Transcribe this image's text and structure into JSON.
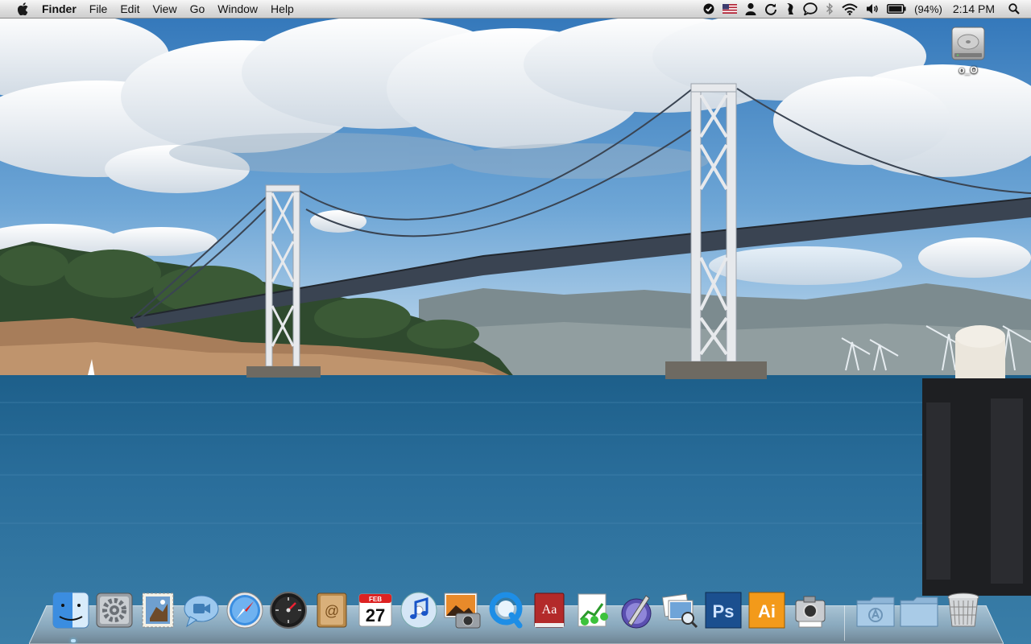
{
  "menubar": {
    "apple_icon": "apple-logo",
    "app_name": "Finder",
    "menus": [
      "File",
      "Edit",
      "View",
      "Go",
      "Window",
      "Help"
    ],
    "status_items": [
      "checkmark-circle-icon",
      "us-flag-icon",
      "user-icon",
      "time-machine-sync-icon",
      "script-icon",
      "speech-bubble-icon",
      "bluetooth-icon",
      "wifi-icon",
      "volume-icon",
      "battery-icon"
    ],
    "battery_percent": "(94%)",
    "battery_level": 0.94,
    "clock": "2:14 PM",
    "spotlight_icon": "magnifier-icon"
  },
  "desktop": {
    "wallpaper": "San Francisco–Oakland Bay Bridge photo",
    "icons": [
      {
        "icon": "hard-drive-icon",
        "label": "o_O"
      }
    ]
  },
  "dock": {
    "items": [
      {
        "name": "finder",
        "icon": "finder-icon",
        "running": true
      },
      {
        "name": "system-preferences",
        "icon": "gears-icon"
      },
      {
        "name": "mail",
        "icon": "mail-stamp-icon"
      },
      {
        "name": "ichat",
        "icon": "video-chat-bubble-icon"
      },
      {
        "name": "safari",
        "icon": "compass-icon"
      },
      {
        "name": "dashboard",
        "icon": "gauge-icon"
      },
      {
        "name": "address-book",
        "icon": "address-book-icon"
      },
      {
        "name": "ical",
        "icon": "calendar-icon",
        "month": "FEB",
        "day": "27"
      },
      {
        "name": "itunes",
        "icon": "music-note-cd-icon"
      },
      {
        "name": "iphoto",
        "icon": "camera-photo-icon"
      },
      {
        "name": "quicktime",
        "icon": "quicktime-q-icon"
      },
      {
        "name": "dictionary",
        "icon": "dictionary-book-icon",
        "label": "Aa"
      },
      {
        "name": "activity",
        "icon": "chart-people-icon"
      },
      {
        "name": "script-editor",
        "icon": "pen-nib-icon"
      },
      {
        "name": "preview",
        "icon": "photos-magnifier-icon"
      },
      {
        "name": "photoshop",
        "icon": "ps-icon",
        "label": "Ps"
      },
      {
        "name": "illustrator",
        "icon": "ai-icon",
        "label": "Ai"
      },
      {
        "name": "image-capture",
        "icon": "camera-icon"
      },
      {
        "name": "applications-stack",
        "icon": "applications-folder-icon"
      },
      {
        "name": "documents-stack",
        "icon": "folder-icon"
      },
      {
        "name": "trash",
        "icon": "trash-icon"
      }
    ]
  },
  "colors": {
    "menubar_top": "#f6f6f6",
    "menubar_bottom": "#cfcfcf",
    "sky": "#3f86c6",
    "water": "#2a6a97",
    "photoshop": "#1b4f8f",
    "illustrator": "#f39a1a",
    "dictionary": "#b32a2a"
  }
}
